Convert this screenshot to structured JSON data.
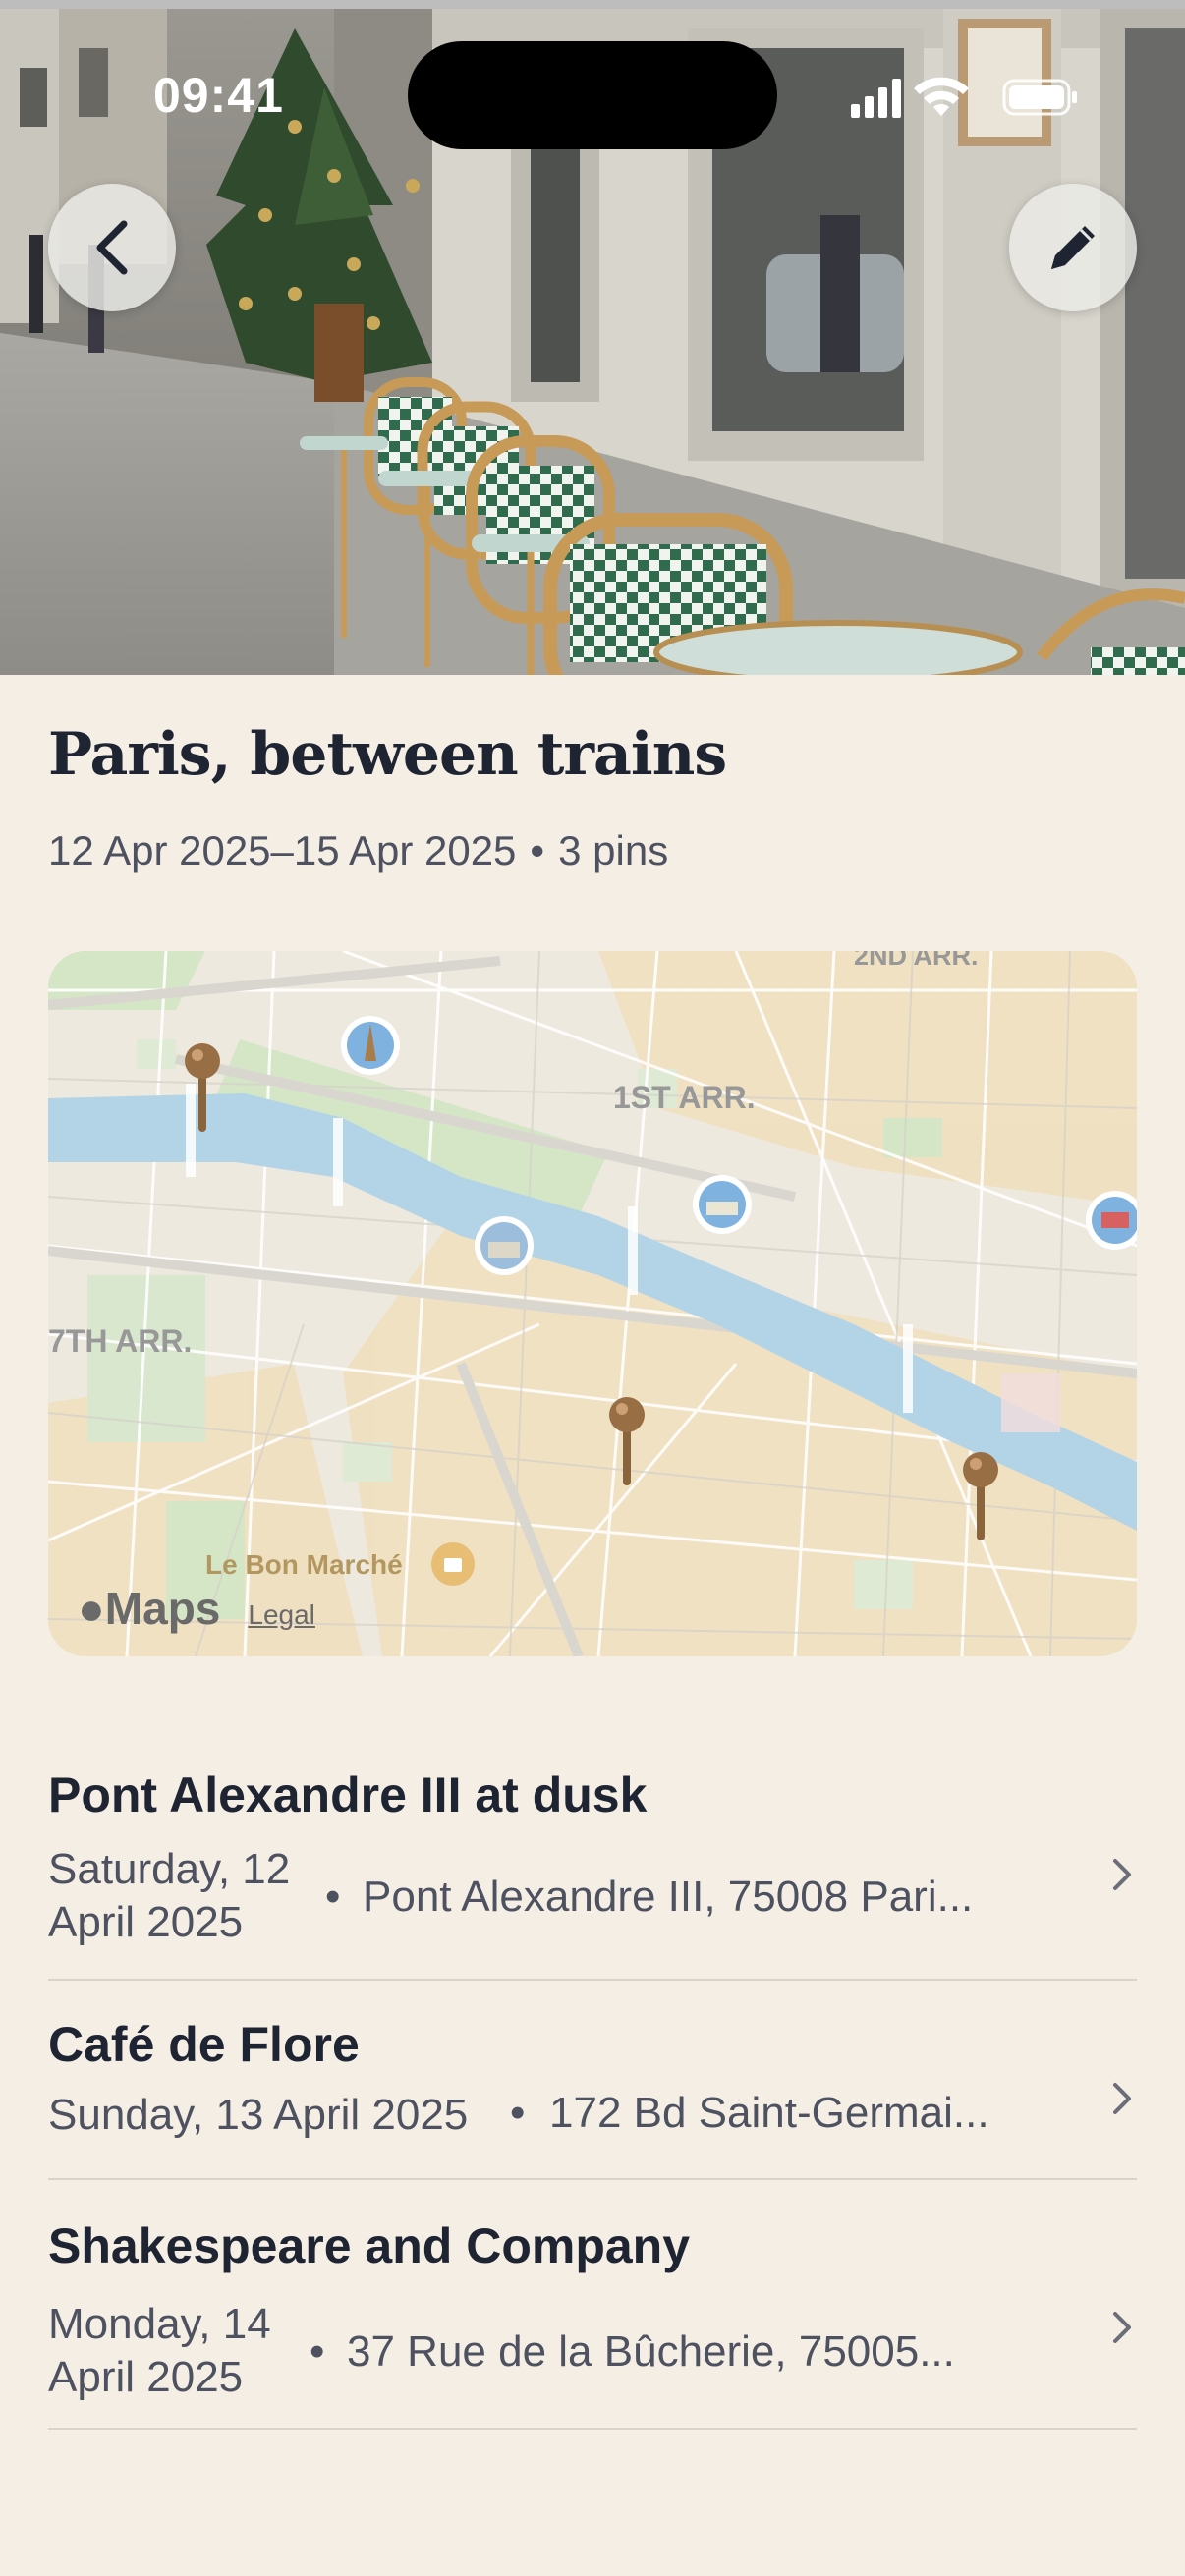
{
  "status_bar": {
    "time": "09:41"
  },
  "header": {
    "back_icon": "chevron-left-icon",
    "edit_icon": "pencil-icon"
  },
  "trip": {
    "title": "Paris, between trains",
    "date_range": "12 Apr 2025–15 Apr 2025",
    "separator": "•",
    "pin_count": "3 pins"
  },
  "map": {
    "labels": {
      "arr_2": "2ND ARR.",
      "arr_1": "1ST ARR.",
      "arr_7": "7TH ARR.",
      "bon_marche": "Le Bon Marché"
    },
    "brand": "Maps",
    "legal": "Legal"
  },
  "pins": [
    {
      "title": "Pont Alexandre III at dusk",
      "date": "Saturday, 12 April 2025",
      "separator": "•",
      "address": "Pont Alexandre III, 75008 Pari..."
    },
    {
      "title": "Café de Flore",
      "date": "Sunday, 13 April 2025",
      "separator": "•",
      "address": "172 Bd Saint-Germai..."
    },
    {
      "title": "Shakespeare and Company",
      "date": "Monday, 14 April 2025",
      "separator": "•",
      "address": "37 Rue de la Bûcherie, 75005..."
    }
  ],
  "colors": {
    "background": "#f4eee5",
    "river": "#a9cfe3",
    "pin": "#8a5a2b"
  }
}
